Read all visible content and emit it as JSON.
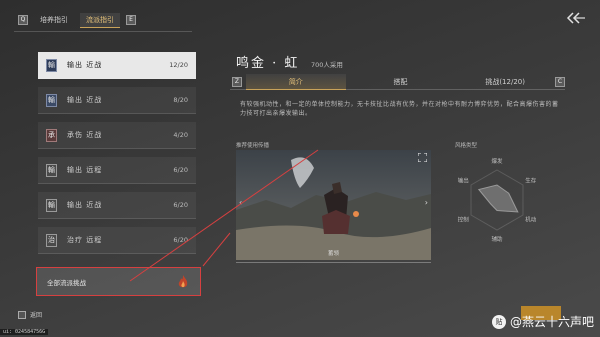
{
  "header": {
    "key_left": "Q",
    "tabs": [
      {
        "label": "培养指引",
        "active": false
      },
      {
        "label": "流派指引",
        "active": true
      }
    ],
    "key_right": "E",
    "back_icon": "back-arrow-icon"
  },
  "builds": [
    {
      "icon": "輸",
      "role": "输出 近战",
      "count": "12/20",
      "active": true
    },
    {
      "icon": "輸",
      "role": "输出 近战",
      "count": "8/20",
      "active": false
    },
    {
      "icon": "承",
      "role": "承伤 近战",
      "count": "4/20",
      "active": false
    },
    {
      "icon": "輸",
      "role": "输出 远程",
      "count": "6/20",
      "active": false
    },
    {
      "icon": "輸",
      "role": "输出 近战",
      "count": "6/20",
      "active": false
    },
    {
      "icon": "治",
      "role": "治疗 远程",
      "count": "6/20",
      "active": false
    }
  ],
  "all_builds": {
    "label": "全部流派挑战",
    "icon": "flame-icon"
  },
  "footer": {
    "key": "Esc",
    "label": "返回"
  },
  "coords": "ui: 024584756G",
  "detail": {
    "title": "鸣金 · 虹",
    "users": "700人采用",
    "key_left": "Z",
    "key_right": "C",
    "subtabs": [
      {
        "label": "简介",
        "active": true
      },
      {
        "label": "搭配",
        "active": false
      },
      {
        "label": "挑战(12/20)",
        "active": false
      }
    ],
    "description": "有较强机动性，和一定的单体控制能力，无卡技扯比战有优势，并在对枪中有耐力博弈优势，配合高爆伤害的蓄力技可打出亲爆发输出。",
    "video_label": "推荐使用传播",
    "video_caption": "蓄领",
    "radar_label": "风格类型",
    "radar_axes": [
      "爆发",
      "生存",
      "机动",
      "辅助",
      "控制",
      "输出"
    ],
    "radar_values": [
      0.5,
      0.45,
      0.8,
      0.35,
      0.25,
      0.7
    ]
  },
  "watermark": {
    "text": "@燕云十六声吧",
    "logo": "贴"
  },
  "colors": {
    "accent": "#e6c27a",
    "highlight_box": "#d64040",
    "confirm": "#b9862b"
  }
}
